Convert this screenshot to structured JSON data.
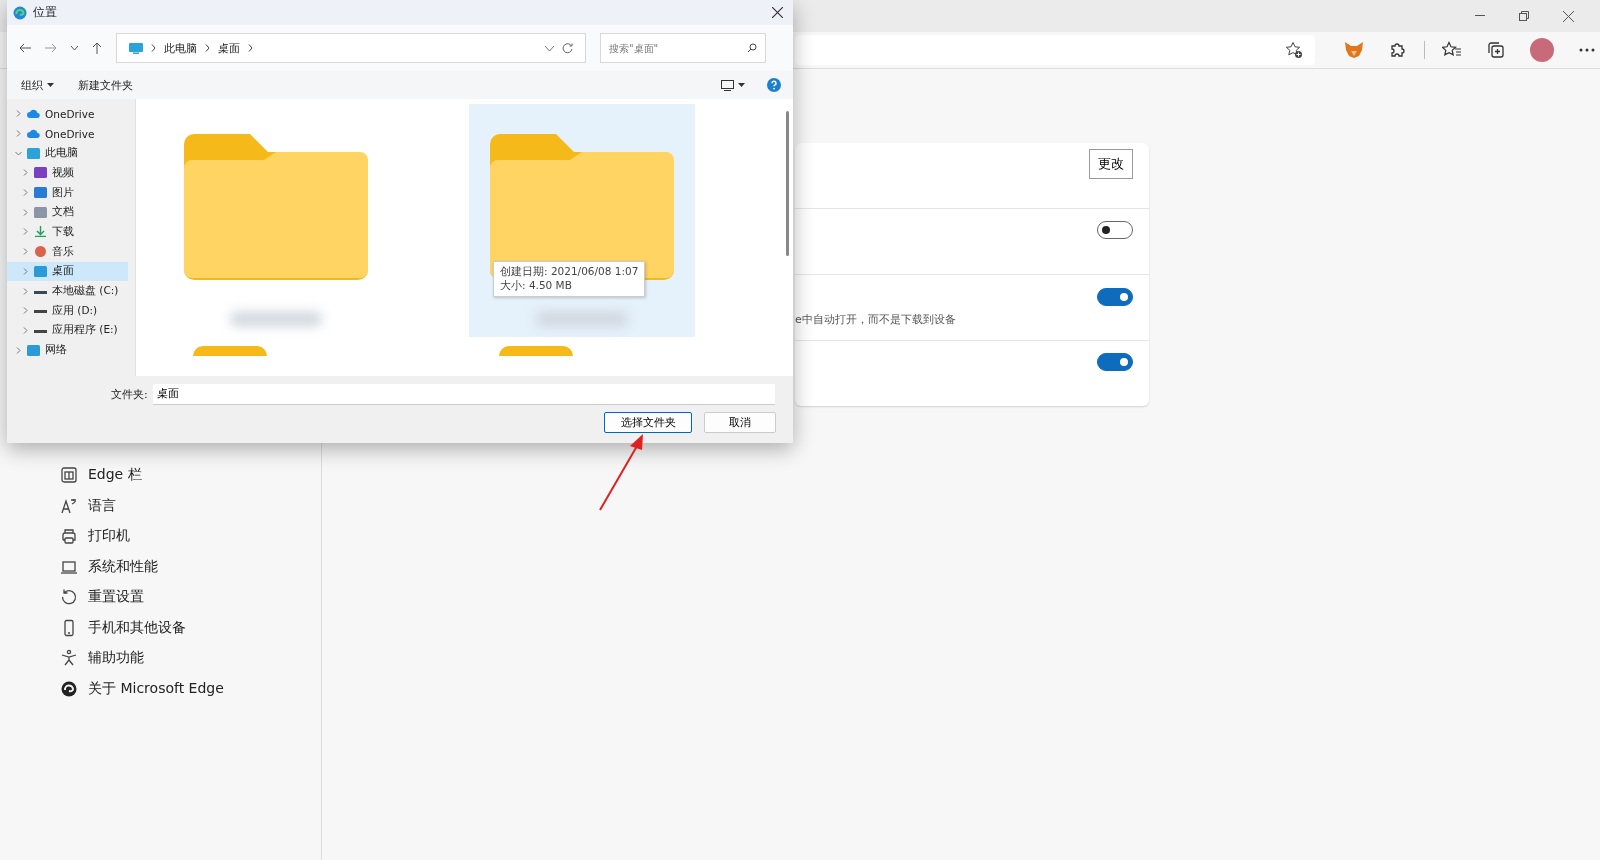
{
  "dialog": {
    "title": "位置",
    "breadcrumb": [
      "此电脑",
      "桌面"
    ],
    "search": {
      "placeholder": "搜索\"桌面\""
    },
    "toolbar": [
      "组织",
      "新建文件夹"
    ],
    "tree": [
      {
        "label": "OneDrive",
        "kind": "cloud",
        "expanded": false,
        "selected": false
      },
      {
        "label": "OneDrive",
        "kind": "cloud",
        "expanded": false,
        "selected": false
      },
      {
        "label": "此电脑",
        "kind": "pc",
        "expanded": true,
        "selected": false,
        "children": [
          {
            "label": "视频",
            "kind": "video",
            "expanded": false,
            "selected": false
          },
          {
            "label": "图片",
            "kind": "pictures",
            "expanded": false,
            "selected": false
          },
          {
            "label": "文档",
            "kind": "docs",
            "expanded": false,
            "selected": false
          },
          {
            "label": "下载",
            "kind": "download",
            "expanded": false,
            "selected": false
          },
          {
            "label": "音乐",
            "kind": "music",
            "expanded": false,
            "selected": false
          },
          {
            "label": "桌面",
            "kind": "desktop",
            "expanded": false,
            "selected": true
          },
          {
            "label": "本地磁盘 (C:)",
            "kind": "system-drive",
            "expanded": false,
            "selected": false
          },
          {
            "label": "应用 (D:)",
            "kind": "drive",
            "expanded": false,
            "selected": false
          },
          {
            "label": "应用程序 (E:)",
            "kind": "drive",
            "expanded": false,
            "selected": false
          }
        ]
      },
      {
        "label": "网络",
        "kind": "network",
        "expanded": false,
        "selected": false
      }
    ],
    "files": [
      {
        "selected": false
      },
      {
        "selected": true,
        "tooltip": [
          "创建日期: 2021/06/08 1:07",
          "大小: 4.50 MB"
        ]
      }
    ],
    "folder_field": {
      "label": "文件夹:",
      "value": "桌面"
    },
    "buttons": [
      "选择文件夹",
      "取消"
    ]
  },
  "settings_sidebar": [
    {
      "label": "Edge 栏",
      "kind": "bar"
    },
    {
      "label": "语言",
      "kind": "language"
    },
    {
      "label": "打印机",
      "kind": "printer"
    },
    {
      "label": "系统和性能",
      "kind": "laptop"
    },
    {
      "label": "重置设置",
      "kind": "reset"
    },
    {
      "label": "手机和其他设备",
      "kind": "phone"
    },
    {
      "label": "辅助功能",
      "kind": "accessibility"
    },
    {
      "label": "关于 Microsoft Edge",
      "kind": "edge"
    }
  ],
  "settings_card": [
    {
      "kind": "button",
      "button": "更改"
    },
    {
      "kind": "toggle",
      "on": false
    },
    {
      "kind": "toggle",
      "on": true,
      "description": "e中自动打开，而不是下载到设备"
    },
    {
      "kind": "toggle",
      "on": true
    }
  ]
}
